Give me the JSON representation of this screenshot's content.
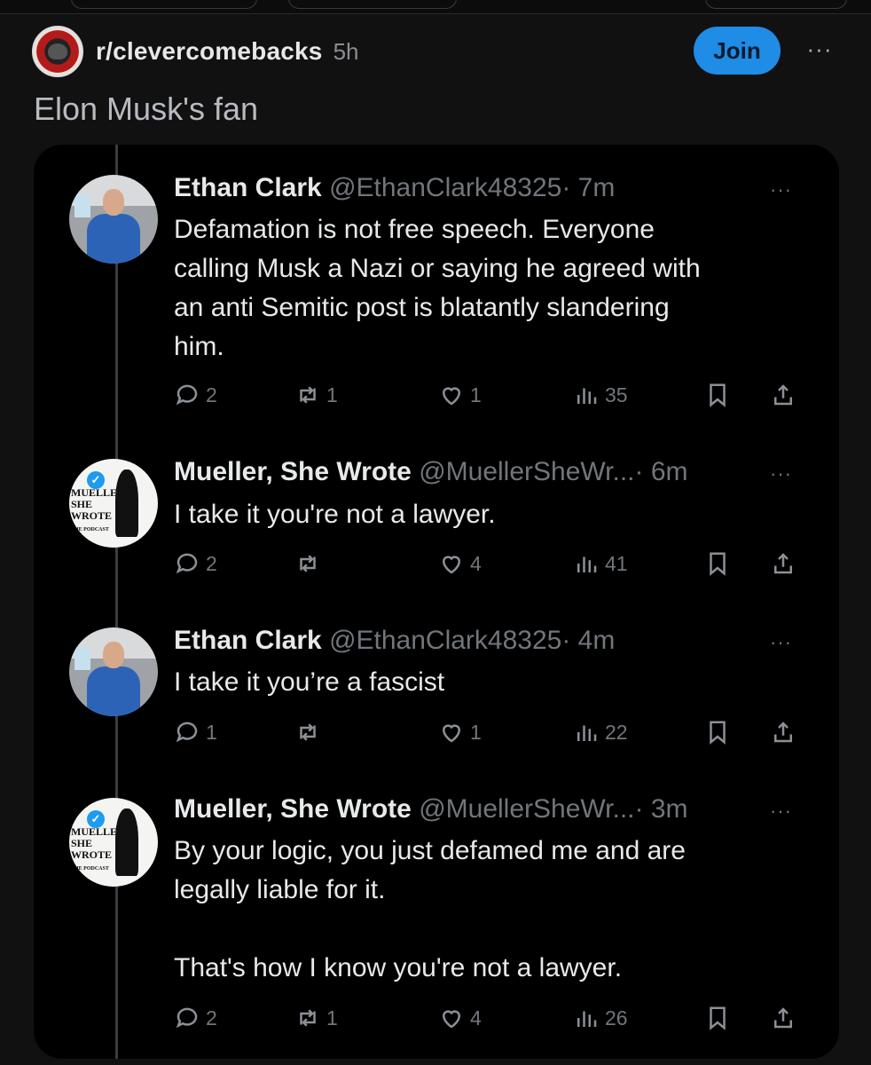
{
  "subreddit": {
    "name": "r/clevercomebacks",
    "age": "5h",
    "join_label": "Join",
    "more_label": "···"
  },
  "post": {
    "title": "Elon Musk's fan"
  },
  "tweets": [
    {
      "name": "Ethan Clark",
      "handle": "@EthanClark48325",
      "time": "· 7m",
      "text": "Defamation is not free speech. Everyone\ncalling Musk a Nazi or saying he agreed with\nan anti Semitic post is blatantly slandering\nhim.",
      "replies": "2",
      "reposts": "1",
      "likes": "1",
      "views": "35"
    },
    {
      "name": "Mueller, She Wrote",
      "handle": "@MuellerSheWr...",
      "time": "· 6m",
      "text": "I take it you're not a lawyer.",
      "replies": "2",
      "reposts": "",
      "likes": "4",
      "views": "41"
    },
    {
      "name": "Ethan Clark",
      "handle": "@EthanClark48325",
      "time": "· 4m",
      "text": "I take it you’re a fascist",
      "replies": "1",
      "reposts": "",
      "likes": "1",
      "views": "22"
    },
    {
      "name": "Mueller, She Wrote",
      "handle": "@MuellerSheWr...",
      "time": "· 3m",
      "text": "By your logic, you just defamed me and are\nlegally liable for it.\n\nThat's how I know you're not a lawyer.",
      "replies": "2",
      "reposts": "1",
      "likes": "4",
      "views": "26"
    }
  ],
  "logo_text": {
    "line1": "MUELLER,",
    "line2": "SHE WROTE",
    "line3": "THE PODCAST"
  },
  "tweet_more_label": "···",
  "icons": [
    "reply-icon",
    "repost-icon",
    "like-icon",
    "views-icon",
    "bookmark-icon",
    "share-icon"
  ],
  "colors": {
    "background": "#111112",
    "card": "#000000",
    "join": "#1f8ce6",
    "muted": "#71767b",
    "text": "#e7e9ea"
  }
}
